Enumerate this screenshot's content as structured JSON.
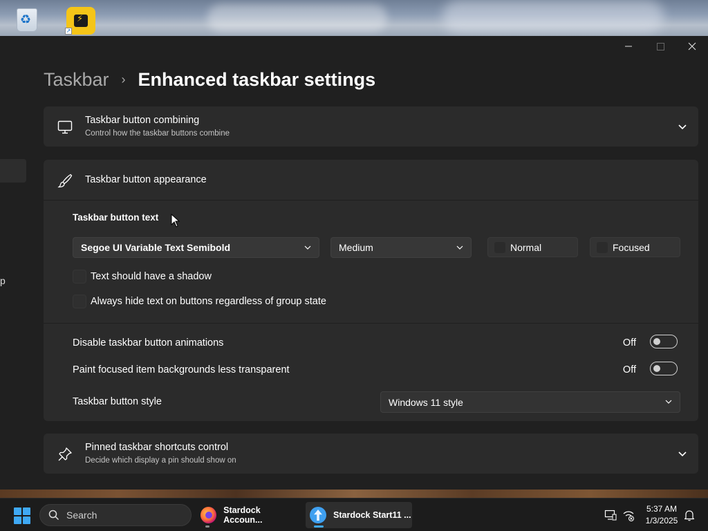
{
  "desktop": {
    "icons": [
      "recycle-bin-icon",
      "start11-shortcut-icon"
    ]
  },
  "window": {
    "controls": [
      "minimize",
      "maximize",
      "close"
    ],
    "sidebar_fragment": "p"
  },
  "breadcrumb": {
    "parent": "Taskbar",
    "separator": "›",
    "current": "Enhanced taskbar settings"
  },
  "cards": {
    "combining": {
      "title": "Taskbar button combining",
      "subtitle": "Control how the taskbar buttons combine",
      "icon": "monitor-icon",
      "expanded": false
    },
    "appearance": {
      "title": "Taskbar button appearance",
      "icon": "brush-icon",
      "expanded": true,
      "text_section": {
        "label": "Taskbar button text",
        "font_value": "Segoe UI Variable Text Semibold",
        "size_value": "Medium",
        "chip_normal": "Normal",
        "chip_focused": "Focused",
        "shadow_label": "Text should have a shadow",
        "shadow_checked": false,
        "hide_label": "Always hide text on buttons regardless of group state",
        "hide_checked": false
      },
      "disable_animations": {
        "label": "Disable taskbar button animations",
        "state": "Off",
        "on": false
      },
      "paint_focused": {
        "label": "Paint focused item backgrounds less transparent",
        "state": "Off",
        "on": false
      },
      "button_style": {
        "label": "Taskbar button style",
        "value": "Windows 11 style"
      }
    },
    "pinned": {
      "title": "Pinned taskbar shortcuts control",
      "subtitle": "Decide which display a pin should show on",
      "icon": "pin-icon",
      "expanded": false
    }
  },
  "taskbar": {
    "search_placeholder": "Search",
    "apps": [
      {
        "label": "Stardock Accoun...",
        "icon": "firefox-icon",
        "active": false
      },
      {
        "label": "Stardock Start11 ...",
        "icon": "start11-icon",
        "active": true
      }
    ],
    "clock_time": "5:37 AM",
    "clock_date": "1/3/2025"
  },
  "colors": {
    "accent": "#3fa9f5",
    "window_bg": "#202020",
    "card_bg": "#2b2b2b",
    "taskbar_bg": "#1c1c1c"
  }
}
